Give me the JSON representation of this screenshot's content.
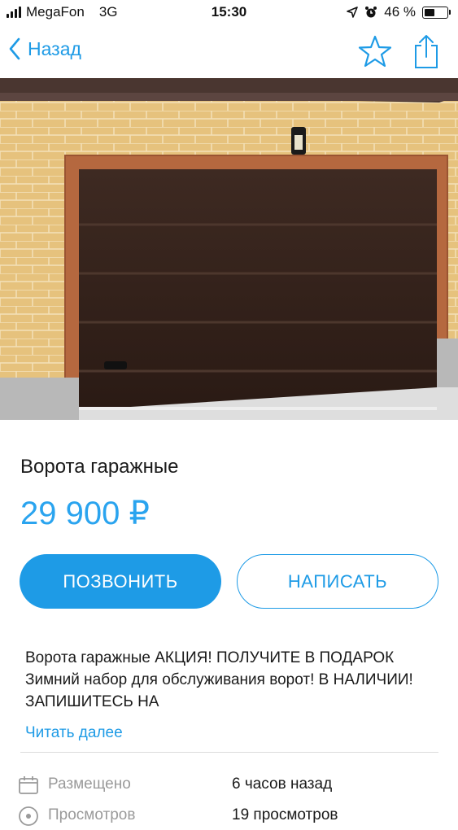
{
  "status_bar": {
    "carrier": "MegaFon",
    "network": "3G",
    "time": "15:30",
    "battery": "46 %",
    "battery_level": 0.46
  },
  "nav": {
    "back_label": "Назад",
    "favorite_icon": "star-outline-icon",
    "share_icon": "share-icon"
  },
  "listing": {
    "image_description_icon": "garage-door-photo",
    "title": "Ворота гаражные",
    "price": "29 900 ₽",
    "call_label": "ПОЗВОНИТЬ",
    "write_label": "НАПИСАТЬ",
    "description": "Ворота гаражные АКЦИЯ! ПОЛУЧИТЕ В ПОДАРОК Зимний набор для обслуживания ворот! В НАЛИЧИИ! ЗАПИШИТЕСЬ НА",
    "read_more": "Читать далее"
  },
  "meta": [
    {
      "icon": "calendar-icon",
      "label": "Размещено",
      "value": "6 часов назад"
    },
    {
      "icon": "eye-icon",
      "label": "Просмотров",
      "value": "19 просмотров"
    }
  ],
  "colors": {
    "accent": "#1e9be6",
    "price": "#2aa4ef",
    "muted": "#9a9a9a"
  }
}
